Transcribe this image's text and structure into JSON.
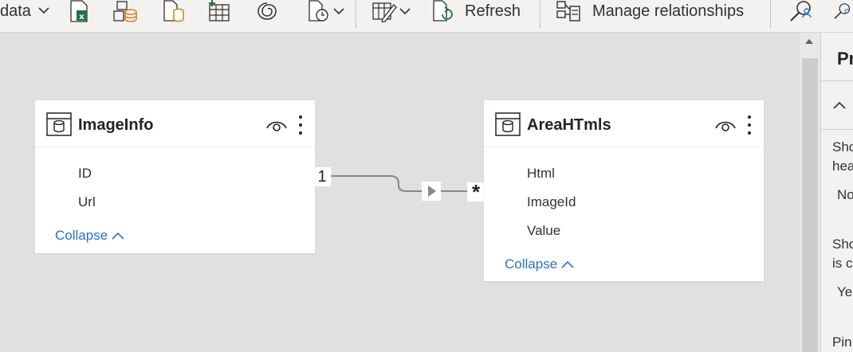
{
  "toolbar": {
    "get_data_label": "data",
    "refresh_label": "Refresh",
    "manage_relationships_label": "Manage relationships"
  },
  "canvas": {
    "tables": [
      {
        "name": "ImageInfo",
        "fields": [
          "ID",
          "Url"
        ],
        "collapse_label": "Collapse"
      },
      {
        "name": "AreaHTmls",
        "fields": [
          "Html",
          "ImageId",
          "Value"
        ],
        "collapse_label": "Collapse"
      }
    ],
    "relationship": {
      "from_cardinality": "1",
      "to_cardinality": "*"
    }
  },
  "properties_pane": {
    "title": "Pr",
    "item1_label_line1": "Sho",
    "item1_label_line2": "hea",
    "item1_value": "No",
    "item2_label_line1": "Sho",
    "item2_label_line2": "is c",
    "item2_value": "Yes",
    "item3_label": "Pin"
  },
  "colors": {
    "canvas_bg": "#e1e0df",
    "toolbar_bg": "#f3f2f1",
    "link_blue": "#2674c5",
    "excel_green": "#217346",
    "data_orange": "#d4862b"
  }
}
